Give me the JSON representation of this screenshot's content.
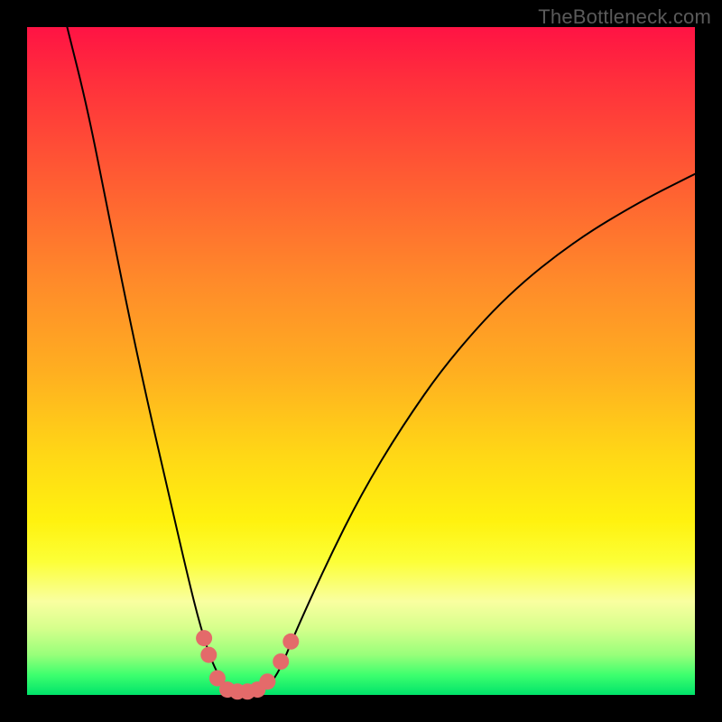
{
  "watermark": "TheBottleneck.com",
  "chart_data": {
    "type": "line",
    "title": "",
    "xlabel": "",
    "ylabel": "",
    "xlim": [
      0,
      100
    ],
    "ylim": [
      0,
      100
    ],
    "grid": false,
    "background_gradient": [
      "#ff1344",
      "#ffd716",
      "#00e36a"
    ],
    "series": [
      {
        "name": "curve",
        "points": [
          {
            "x": 6,
            "y": 100
          },
          {
            "x": 9,
            "y": 88
          },
          {
            "x": 12,
            "y": 73
          },
          {
            "x": 15,
            "y": 58
          },
          {
            "x": 18,
            "y": 44
          },
          {
            "x": 21,
            "y": 31
          },
          {
            "x": 24,
            "y": 18
          },
          {
            "x": 26,
            "y": 10
          },
          {
            "x": 28,
            "y": 4
          },
          {
            "x": 30,
            "y": 1
          },
          {
            "x": 33,
            "y": 0
          },
          {
            "x": 36,
            "y": 1
          },
          {
            "x": 38,
            "y": 4
          },
          {
            "x": 40,
            "y": 9
          },
          {
            "x": 45,
            "y": 20
          },
          {
            "x": 50,
            "y": 30
          },
          {
            "x": 56,
            "y": 40
          },
          {
            "x": 63,
            "y": 50
          },
          {
            "x": 72,
            "y": 60
          },
          {
            "x": 82,
            "y": 68
          },
          {
            "x": 92,
            "y": 74
          },
          {
            "x": 100,
            "y": 78
          }
        ]
      }
    ],
    "markers": [
      {
        "x": 26.5,
        "y": 8.5
      },
      {
        "x": 27.2,
        "y": 6.0
      },
      {
        "x": 28.5,
        "y": 2.5
      },
      {
        "x": 30.0,
        "y": 0.8
      },
      {
        "x": 31.5,
        "y": 0.5
      },
      {
        "x": 33.0,
        "y": 0.5
      },
      {
        "x": 34.5,
        "y": 0.8
      },
      {
        "x": 36.0,
        "y": 2.0
      },
      {
        "x": 38.0,
        "y": 5.0
      },
      {
        "x": 39.5,
        "y": 8.0
      }
    ]
  }
}
